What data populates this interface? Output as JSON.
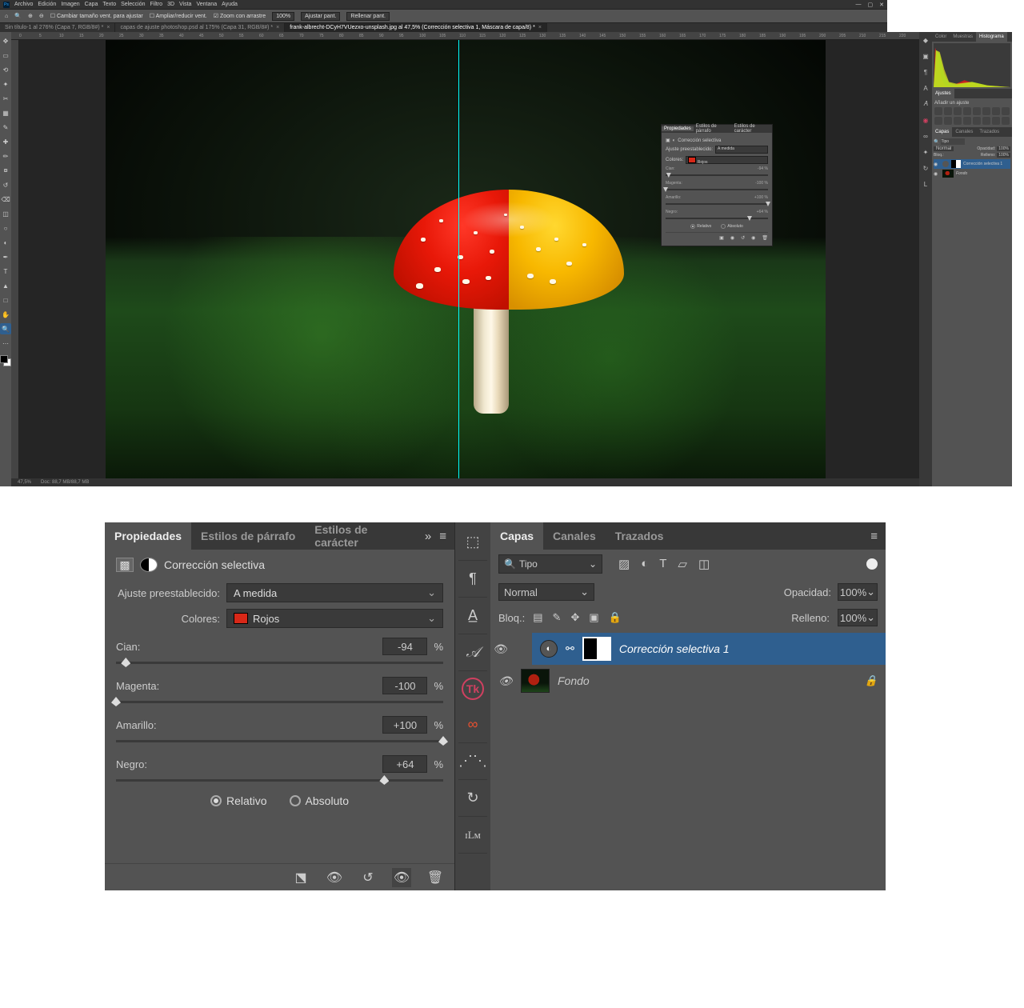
{
  "menubar": {
    "items": [
      "Archivo",
      "Edición",
      "Imagen",
      "Capa",
      "Texto",
      "Selección",
      "Filtro",
      "3D",
      "Vista",
      "Ventana",
      "Ayuda"
    ]
  },
  "optionbar": {
    "t1": "Cambiar tamaño vent. para ajustar",
    "t2": "Ampliar/reducir vent.",
    "t3": "Zoom con arrastre",
    "zoom": "100%",
    "t4": "Ajustar pant.",
    "t5": "Rellenar pant."
  },
  "tabs": [
    {
      "label": "Sin título-1 al 276% (Capa 7, RGB/8#) *",
      "active": false
    },
    {
      "label": "capas de ajuste photoshop.psd al 175% (Capa 31, RGB/8#) *",
      "active": false
    },
    {
      "label": "frank-albrecht-DCyH7VUezxo-unsplash.jpg al 47,5% (Corrección selectiva 1, Máscara de capa/8) *",
      "active": true
    }
  ],
  "statusbar": {
    "zoom": "47,5%",
    "doc": "Doc: 88,7 MB/88,7 MB"
  },
  "rpanels": {
    "tabs1": [
      "Color",
      "Muestras",
      "Histograma"
    ],
    "adjustments_title": "Ajustes",
    "adjustments_sub": "Añadir un ajuste",
    "tabs2": [
      "Capas",
      "Canales",
      "Trazados"
    ]
  },
  "layers_mini": {
    "filter_label": "Tipo",
    "blend": "Normal",
    "opacity_label": "Opacidad:",
    "opacity_value": "100%",
    "fill_label": "Relleno:",
    "fill_value": "100%",
    "lock_label": "Bloq.:",
    "rows": [
      {
        "name": "Corrección selectiva 1",
        "selected": true
      },
      {
        "name": "Fondo",
        "selected": false
      }
    ]
  },
  "float_props": {
    "tabs": [
      "Propiedades",
      "Estilos de párrafo",
      "Estilos de carácter"
    ],
    "title": "Corrección selectiva",
    "preset_label": "Ajuste preestablecido:",
    "preset_value": "A medida",
    "colors_label": "Colores:",
    "colors_value": "Rojos",
    "sliders": [
      {
        "name": "Cian:",
        "value": "-94",
        "pos": 3
      },
      {
        "name": "Magenta:",
        "value": "-100",
        "pos": 0
      },
      {
        "name": "Amarillo:",
        "value": "+100",
        "pos": 100
      },
      {
        "name": "Negro:",
        "value": "+64",
        "pos": 82
      }
    ],
    "mode_relative": "Relativo",
    "mode_absolute": "Absoluto"
  },
  "detail_props": {
    "tabs": [
      "Propiedades",
      "Estilos de párrafo",
      "Estilos de carácter"
    ],
    "title": "Corrección selectiva",
    "preset_label": "Ajuste preestablecido:",
    "preset_value": "A medida",
    "colors_label": "Colores:",
    "colors_value": "Rojos",
    "sliders": [
      {
        "name": "Cian:",
        "value": "-94",
        "pos": 3
      },
      {
        "name": "Magenta:",
        "value": "-100",
        "pos": 0
      },
      {
        "name": "Amarillo:",
        "value": "+100",
        "pos": 100
      },
      {
        "name": "Negro:",
        "value": "+64",
        "pos": 82
      }
    ],
    "mode_relative": "Relativo",
    "mode_absolute": "Absoluto"
  },
  "detail_layers": {
    "tabs": [
      "Capas",
      "Canales",
      "Trazados"
    ],
    "filter_label": "Tipo",
    "blend": "Normal",
    "opacity_label": "Opacidad:",
    "opacity_value": "100%",
    "lock_label": "Bloq.:",
    "fill_label": "Relleno:",
    "fill_value": "100%",
    "rows": [
      {
        "name": "Corrección selectiva 1",
        "selected": true,
        "type": "adjustment"
      },
      {
        "name": "Fondo",
        "selected": false,
        "type": "background"
      }
    ]
  }
}
